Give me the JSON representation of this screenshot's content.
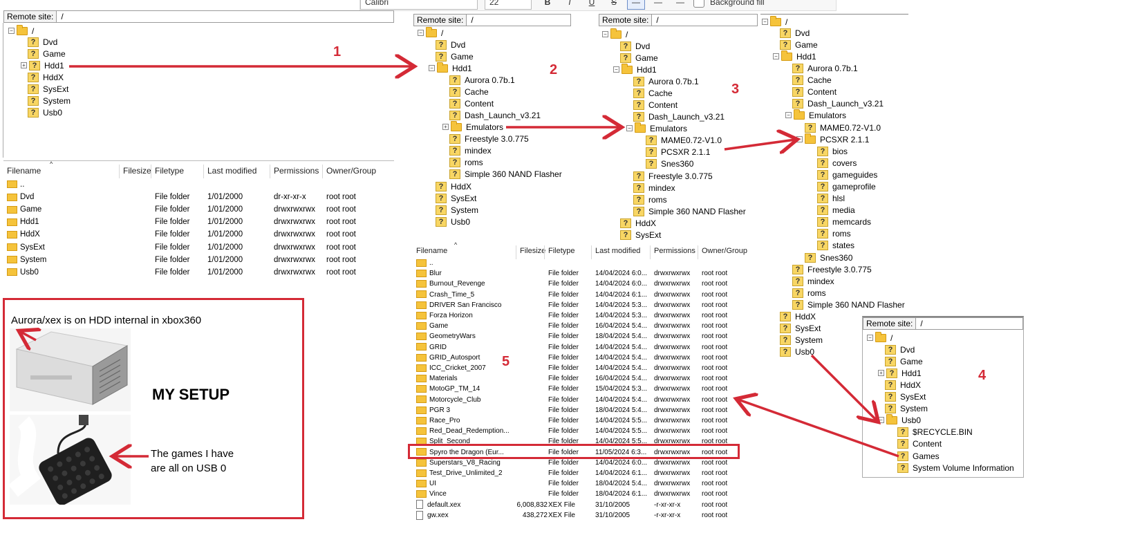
{
  "toolbar": {
    "font_name": "Calibri",
    "font_size": "22",
    "bold": "B",
    "italic": "I",
    "underline": "U",
    "strike": "S",
    "align_left": "—",
    "align_center": "—",
    "align_right": "—",
    "background_fill": "Background fill"
  },
  "remote_label": "Remote site:",
  "remote_value": "/",
  "tree1": {
    "root": "/",
    "items": [
      "Dvd",
      "Game",
      "Hdd1",
      "HddX",
      "SysExt",
      "System",
      "Usb0"
    ]
  },
  "list1": {
    "columns": [
      "Filename",
      "Filesize",
      "Filetype",
      "Last modified",
      "Permissions",
      "Owner/Group"
    ],
    "rows": [
      {
        "name": "..",
        "size": "",
        "type": "",
        "modified": "",
        "perm": "",
        "owner": ""
      },
      {
        "name": "Dvd",
        "size": "",
        "type": "File folder",
        "modified": "1/01/2000",
        "perm": "dr-xr-xr-x",
        "owner": "root root"
      },
      {
        "name": "Game",
        "size": "",
        "type": "File folder",
        "modified": "1/01/2000",
        "perm": "drwxrwxrwx",
        "owner": "root root"
      },
      {
        "name": "Hdd1",
        "size": "",
        "type": "File folder",
        "modified": "1/01/2000",
        "perm": "drwxrwxrwx",
        "owner": "root root"
      },
      {
        "name": "HddX",
        "size": "",
        "type": "File folder",
        "modified": "1/01/2000",
        "perm": "drwxrwxrwx",
        "owner": "root root"
      },
      {
        "name": "SysExt",
        "size": "",
        "type": "File folder",
        "modified": "1/01/2000",
        "perm": "drwxrwxrwx",
        "owner": "root root"
      },
      {
        "name": "System",
        "size": "",
        "type": "File folder",
        "modified": "1/01/2000",
        "perm": "drwxrwxrwx",
        "owner": "root root"
      },
      {
        "name": "Usb0",
        "size": "",
        "type": "File folder",
        "modified": "1/01/2000",
        "perm": "drwxrwxrwx",
        "owner": "root root"
      }
    ]
  },
  "tree2": {
    "root": "/",
    "items": [
      "Dvd",
      "Game",
      "Hdd1",
      "Aurora 0.7b.1",
      "Cache",
      "Content",
      "Dash_Launch_v3.21",
      "Emulators",
      "Freestyle 3.0.775",
      "mindex",
      "roms",
      "Simple 360 NAND Flasher",
      "HddX",
      "SysExt",
      "System",
      "Usb0"
    ]
  },
  "tree3": {
    "root": "/",
    "items": [
      "Dvd",
      "Game",
      "Hdd1",
      "Aurora 0.7b.1",
      "Cache",
      "Content",
      "Dash_Launch_v3.21",
      "Emulators",
      "MAME0.72-V1.0",
      "PCSXR 2.1.1",
      "Snes360",
      "Freestyle 3.0.775",
      "mindex",
      "roms",
      "Simple 360 NAND Flasher",
      "HddX",
      "SysExt"
    ]
  },
  "tree4": {
    "root": "/",
    "items": [
      "Dvd",
      "Game",
      "Hdd1",
      "Aurora 0.7b.1",
      "Cache",
      "Content",
      "Dash_Launch_v3.21",
      "Emulators",
      "MAME0.72-V1.0",
      "PCSXR 2.1.1",
      "bios",
      "covers",
      "gameguides",
      "gameprofile",
      "hlsl",
      "media",
      "memcards",
      "roms",
      "states",
      "Snes360",
      "Freestyle 3.0.775",
      "mindex",
      "roms",
      "Simple 360 NAND Flasher",
      "HddX",
      "SysExt",
      "System",
      "Usb0"
    ]
  },
  "tree5": {
    "root": "/",
    "items": [
      "Dvd",
      "Game",
      "Hdd1",
      "HddX",
      "SysExt",
      "System",
      "Usb0",
      "$RECYCLE.BIN",
      "Content",
      "Games",
      "System Volume Information"
    ]
  },
  "list2": {
    "columns": [
      "Filename",
      "Filesize",
      "Filetype",
      "Last modified",
      "Permissions",
      "Owner/Group"
    ],
    "rows": [
      {
        "name": "..",
        "size": "",
        "type": "",
        "modified": "",
        "perm": "",
        "owner": ""
      },
      {
        "name": "Blur",
        "size": "",
        "type": "File folder",
        "modified": "14/04/2024 6:0...",
        "perm": "drwxrwxrwx",
        "owner": "root root"
      },
      {
        "name": "Burnout_Revenge",
        "size": "",
        "type": "File folder",
        "modified": "14/04/2024 6:0...",
        "perm": "drwxrwxrwx",
        "owner": "root root"
      },
      {
        "name": "Crash_Time_5",
        "size": "",
        "type": "File folder",
        "modified": "14/04/2024 6:1...",
        "perm": "drwxrwxrwx",
        "owner": "root root"
      },
      {
        "name": "DRIVER San Francisco",
        "size": "",
        "type": "File folder",
        "modified": "14/04/2024 5:3...",
        "perm": "drwxrwxrwx",
        "owner": "root root"
      },
      {
        "name": "Forza Horizon",
        "size": "",
        "type": "File folder",
        "modified": "14/04/2024 5:3...",
        "perm": "drwxrwxrwx",
        "owner": "root root"
      },
      {
        "name": "Game",
        "size": "",
        "type": "File folder",
        "modified": "16/04/2024 5:4...",
        "perm": "drwxrwxrwx",
        "owner": "root root"
      },
      {
        "name": "GeometryWars",
        "size": "",
        "type": "File folder",
        "modified": "18/04/2024 5:4...",
        "perm": "drwxrwxrwx",
        "owner": "root root"
      },
      {
        "name": "GRID",
        "size": "",
        "type": "File folder",
        "modified": "14/04/2024 5:4...",
        "perm": "drwxrwxrwx",
        "owner": "root root"
      },
      {
        "name": "GRID_Autosport",
        "size": "",
        "type": "File folder",
        "modified": "14/04/2024 5:4...",
        "perm": "drwxrwxrwx",
        "owner": "root root"
      },
      {
        "name": "ICC_Cricket_2007",
        "size": "",
        "type": "File folder",
        "modified": "14/04/2024 5:4...",
        "perm": "drwxrwxrwx",
        "owner": "root root"
      },
      {
        "name": "Materials",
        "size": "",
        "type": "File folder",
        "modified": "16/04/2024 5:4...",
        "perm": "drwxrwxrwx",
        "owner": "root root"
      },
      {
        "name": "MotoGP_TM_14",
        "size": "",
        "type": "File folder",
        "modified": "15/04/2024 5:3...",
        "perm": "drwxrwxrwx",
        "owner": "root root"
      },
      {
        "name": "Motorcycle_Club",
        "size": "",
        "type": "File folder",
        "modified": "14/04/2024 5:4...",
        "perm": "drwxrwxrwx",
        "owner": "root root"
      },
      {
        "name": "PGR 3",
        "size": "",
        "type": "File folder",
        "modified": "18/04/2024 5:4...",
        "perm": "drwxrwxrwx",
        "owner": "root root"
      },
      {
        "name": "Race_Pro",
        "size": "",
        "type": "File folder",
        "modified": "14/04/2024 5:5...",
        "perm": "drwxrwxrwx",
        "owner": "root root"
      },
      {
        "name": "Red_Dead_Redemption...",
        "size": "",
        "type": "File folder",
        "modified": "14/04/2024 5:5...",
        "perm": "drwxrwxrwx",
        "owner": "root root"
      },
      {
        "name": "Split_Second",
        "size": "",
        "type": "File folder",
        "modified": "14/04/2024 5:5...",
        "perm": "drwxrwxrwx",
        "owner": "root root"
      },
      {
        "name": "Spyro the Dragon (Eur...",
        "size": "",
        "type": "File folder",
        "modified": "11/05/2024 6:3...",
        "perm": "drwxrwxrwx",
        "owner": "root root"
      },
      {
        "name": "Superstars_V8_Racing",
        "size": "",
        "type": "File folder",
        "modified": "14/04/2024 6:0...",
        "perm": "drwxrwxrwx",
        "owner": "root root"
      },
      {
        "name": "Test_Drive_Unlimited_2",
        "size": "",
        "type": "File folder",
        "modified": "14/04/2024 6:1...",
        "perm": "drwxrwxrwx",
        "owner": "root root"
      },
      {
        "name": "UI",
        "size": "",
        "type": "File folder",
        "modified": "18/04/2024 5:4...",
        "perm": "drwxrwxrwx",
        "owner": "root root"
      },
      {
        "name": "Vince",
        "size": "",
        "type": "File folder",
        "modified": "18/04/2024 6:1...",
        "perm": "drwxrwxrwx",
        "owner": "root root"
      },
      {
        "name": "default.xex",
        "size": "6,008,832",
        "type": "XEX File",
        "modified": "31/10/2005",
        "perm": "-r-xr-xr-x",
        "owner": "root root"
      },
      {
        "name": "gw.xex",
        "size": "438,272",
        "type": "XEX File",
        "modified": "31/10/2005",
        "perm": "-r-xr-xr-x",
        "owner": "root root"
      }
    ]
  },
  "annotations": {
    "n1": "1",
    "n2": "2",
    "n3": "3",
    "n4": "4",
    "n5": "5",
    "setup_caption": "Aurora/xex is on HDD internal in xbox360",
    "setup_title": "MY SETUP",
    "games_note_1": "The games I have",
    "games_note_2": "are all on USB 0"
  },
  "colors": {
    "annotation_red": "#d42a36",
    "folder_yellow": "#f5c33b"
  }
}
